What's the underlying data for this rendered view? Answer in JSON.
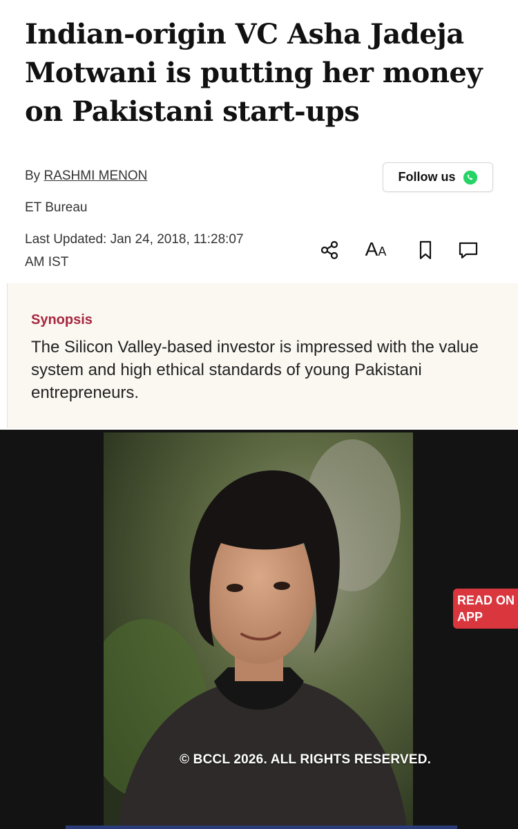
{
  "article": {
    "headline": "Indian-origin VC Asha Jadeja Motwani is putting her money on Pakistani start-ups",
    "by_prefix": "By",
    "author": "RASHMI MENON",
    "bureau": "ET Bureau",
    "last_updated": "Last Updated: Jan 24, 2018, 11:28:07 AM IST"
  },
  "follow": {
    "label": "Follow us",
    "icon": "whatsapp-icon"
  },
  "toolbar": {
    "items": [
      {
        "name": "share-icon"
      },
      {
        "name": "font-size-icon",
        "label_big": "A",
        "label_small": "A"
      },
      {
        "name": "bookmark-icon"
      },
      {
        "name": "comment-icon"
      }
    ]
  },
  "synopsis": {
    "title": "Synopsis",
    "text": "The Silicon Valley-based investor is impressed with the value system and high ethical standards of young Pakistani entrepreneurs."
  },
  "media": {
    "copyright": "© BCCL 2026. ALL RIGHTS RESERVED.",
    "read_on_app": "READ ON APP"
  },
  "colors": {
    "accent": "#a6263e",
    "read_app_bg": "#d9363e",
    "whatsapp": "#25d366",
    "synopsis_bg": "#fbf8f2"
  }
}
